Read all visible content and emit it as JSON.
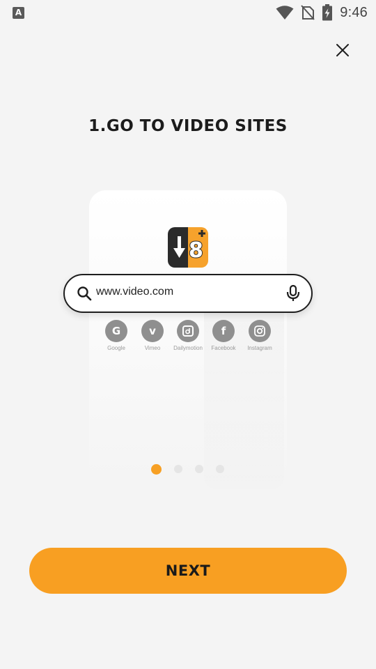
{
  "status_bar": {
    "app_icon_letter": "A",
    "time": "9:46",
    "icons": [
      "wifi-icon",
      "no-sim-icon",
      "battery-charging-icon"
    ]
  },
  "close_icon": "close-icon",
  "title": "1.GO TO VIDEO SITES",
  "illustration": {
    "logo_icon": "download-8-app-logo",
    "search": {
      "text": "www.video.com",
      "left_icon": "search-icon",
      "right_icon": "mic-icon"
    },
    "sites": [
      {
        "label": "Google",
        "glyph": "G",
        "icon": "google-icon"
      },
      {
        "label": "Vimeo",
        "glyph": "v",
        "icon": "vimeo-icon"
      },
      {
        "label": "Dailymotion",
        "glyph": "d",
        "icon": "dailymotion-icon"
      },
      {
        "label": "Facebook",
        "glyph": "f",
        "icon": "facebook-icon"
      },
      {
        "label": "Instagram",
        "glyph": "",
        "icon": "instagram-icon"
      }
    ]
  },
  "pager": {
    "total": 4,
    "active_index": 0
  },
  "next_label": "NEXT",
  "colors": {
    "accent": "#f89f22",
    "background": "#f4f4f4",
    "site_icon": "#8f8f8f",
    "logo_dark": "#2b2b2b"
  }
}
